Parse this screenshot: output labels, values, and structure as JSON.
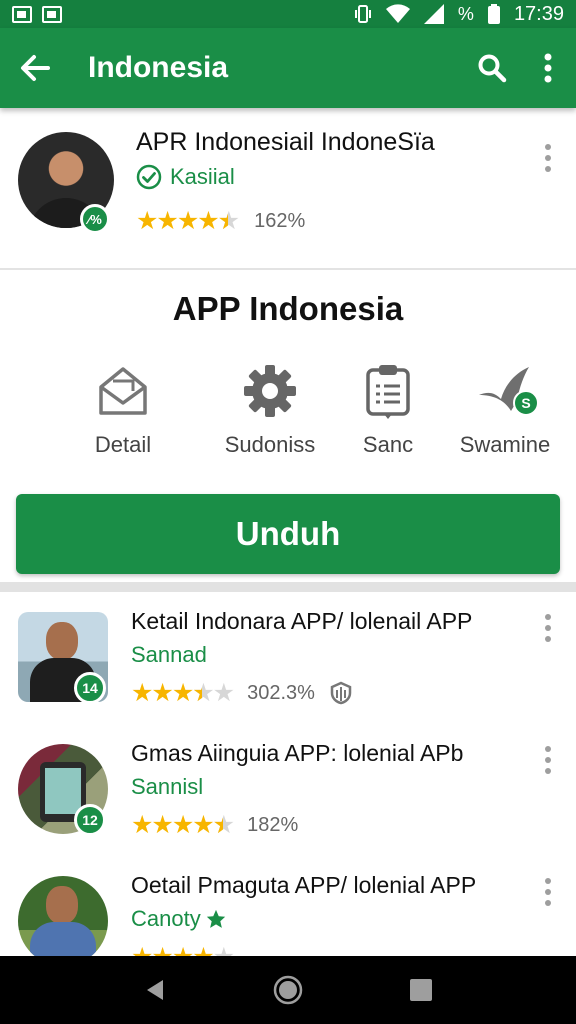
{
  "status_bar": {
    "percent": "%",
    "time": "17:39"
  },
  "app_bar": {
    "title": "Indonesia",
    "icons": [
      "back-arrow-icon",
      "search-icon",
      "more-vert-icon"
    ]
  },
  "hero": {
    "title": "APR Indonesiail IndoneSïa",
    "verified_label": "Kasiial",
    "badge": "⁄%",
    "rating_stars": 4.5,
    "rating_value": "162%"
  },
  "promo": {
    "title": "APP Indonesia",
    "features": [
      {
        "label": "Detail",
        "icon": "envelope-open-icon"
      },
      {
        "label": "Sudoniss",
        "icon": "gear-icon"
      },
      {
        "label": "Sanc",
        "icon": "clipboard-icon"
      },
      {
        "label": "Swamine",
        "icon": "bird-icon",
        "badge": "S"
      }
    ],
    "download_label": "Unduh"
  },
  "list": [
    {
      "title": "Ketail Indonara APP/ lolenail APP",
      "subtitle": "Sannad",
      "badge": "14",
      "rating_stars": 3.5,
      "rating_value": "302.3%",
      "extra_icon": "shield-icon"
    },
    {
      "title": "Gmas Aiinguia APP: lolenial APb",
      "subtitle": "Sannisl",
      "badge": "12",
      "rating_stars": 4.5,
      "rating_value": "182%"
    },
    {
      "title": "Oetail Pmaguta APP/ lolenial APP",
      "subtitle": "Canoty",
      "badge": "",
      "rating_stars": 4,
      "rating_value": "",
      "subtitle_icon": "star-icon"
    }
  ],
  "colors": {
    "primary": "#1a8e47",
    "status_bar": "#15803f",
    "star": "#f7b500",
    "star_empty": "#d7d7d7"
  }
}
